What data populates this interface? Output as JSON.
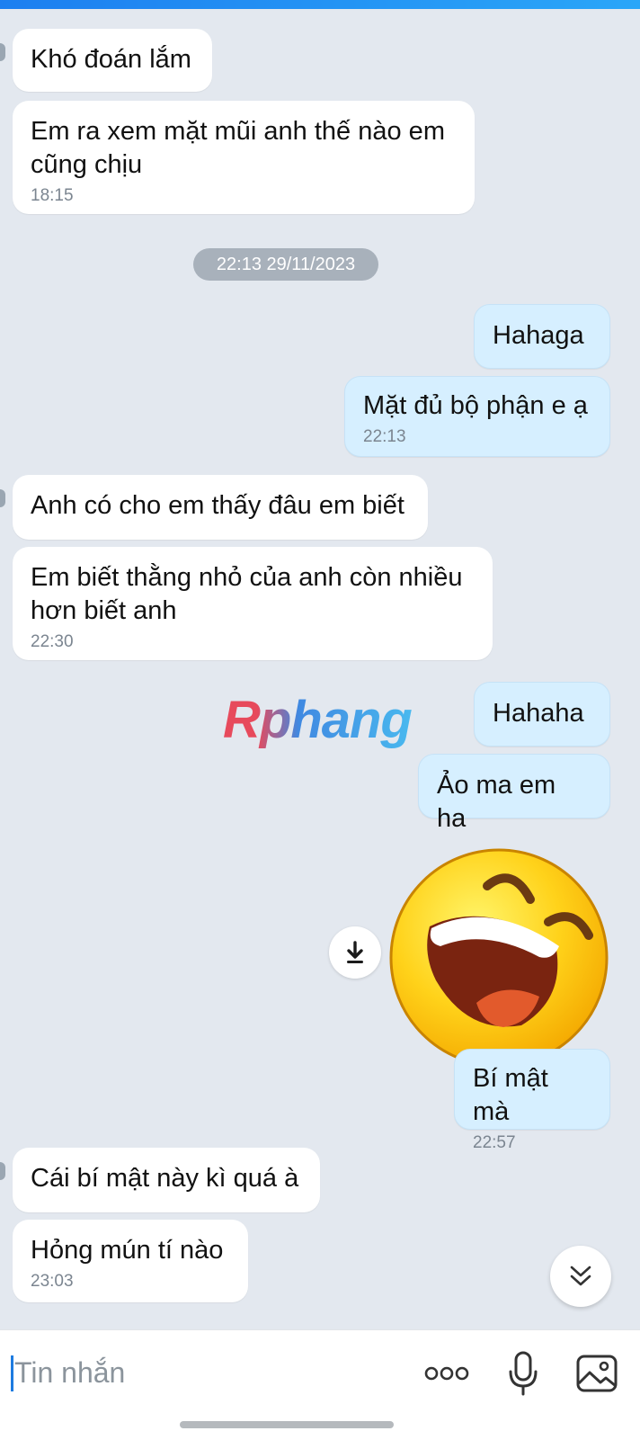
{
  "messages": [
    {
      "text": "Khó đoán lắm",
      "time": ""
    },
    {
      "text": "Em ra xem mặt mũi anh thế nào em cũng chịu",
      "time": "18:15"
    },
    {
      "text": "Hahaga",
      "time": ""
    },
    {
      "text": "Mặt đủ bộ phận e ạ",
      "time": "22:13"
    },
    {
      "text": "Anh có cho em thấy đâu em biết",
      "time": ""
    },
    {
      "text": "Em biết thằng nhỏ của anh còn nhiều hơn biết anh",
      "time": "22:30"
    },
    {
      "text": "Hahaha",
      "time": ""
    },
    {
      "text": "Ảo ma em ha",
      "time": ""
    },
    {
      "text": "Bí mật mà",
      "time": "22:57"
    },
    {
      "text": "Cái bí mật này kì quá à",
      "time": ""
    },
    {
      "text": "Hỏng mún tí nào",
      "time": "23:03"
    }
  ],
  "date_separator": "22:13 29/11/2023",
  "watermark": "Rphang",
  "sticker": {
    "description": "laughing-face sticker",
    "icon": "laughing-emoji"
  },
  "composer": {
    "placeholder": "Tin nhắn"
  },
  "icons": {
    "download": "download-icon",
    "scroll_down": "double-chevron-down-icon",
    "more": "more-icon",
    "mic": "microphone-icon",
    "image": "image-icon"
  },
  "colors": {
    "background": "#e3e8ef",
    "incoming_bubble": "#ffffff",
    "outgoing_bubble": "#d6efff",
    "accent": "#1e7be0"
  }
}
